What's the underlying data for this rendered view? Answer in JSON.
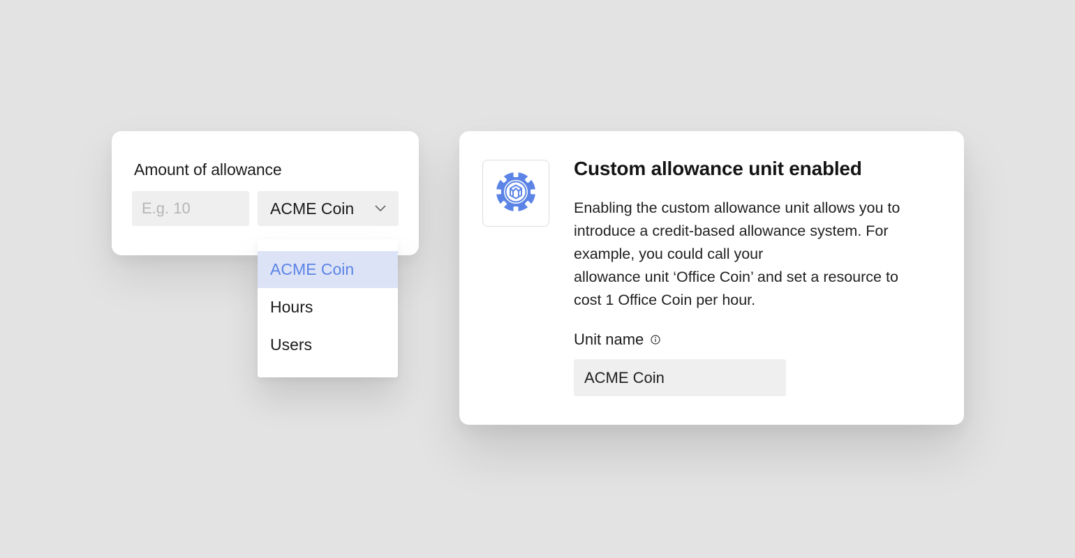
{
  "allowance_card": {
    "label": "Amount of allowance",
    "amount_placeholder": "E.g. 10",
    "amount_value": "",
    "unit_selected": "ACME Coin"
  },
  "dropdown": {
    "options": [
      {
        "label": "ACME Coin",
        "selected": true
      },
      {
        "label": "Hours",
        "selected": false
      },
      {
        "label": "Users",
        "selected": false
      }
    ]
  },
  "info_card": {
    "title": "Custom allowance unit enabled",
    "description_lines": [
      "Enabling the custom allowance unit allows you to",
      "introduce a credit-based allowance system. For",
      "example, you could call your",
      "allowance unit ‘Office Coin’ and set a resource to",
      "cost 1 Office Coin per hour."
    ],
    "unit_name_label": "Unit name",
    "unit_name_value": "ACME Coin"
  },
  "icons": {
    "coin": "coin-icon",
    "chevron": "chevron-down-icon",
    "info": "info-icon"
  },
  "colors": {
    "accent": "#5b84e6",
    "selected_bg": "#dde3f7",
    "field_bg": "#efefef",
    "page_bg": "#e3e3e3"
  }
}
